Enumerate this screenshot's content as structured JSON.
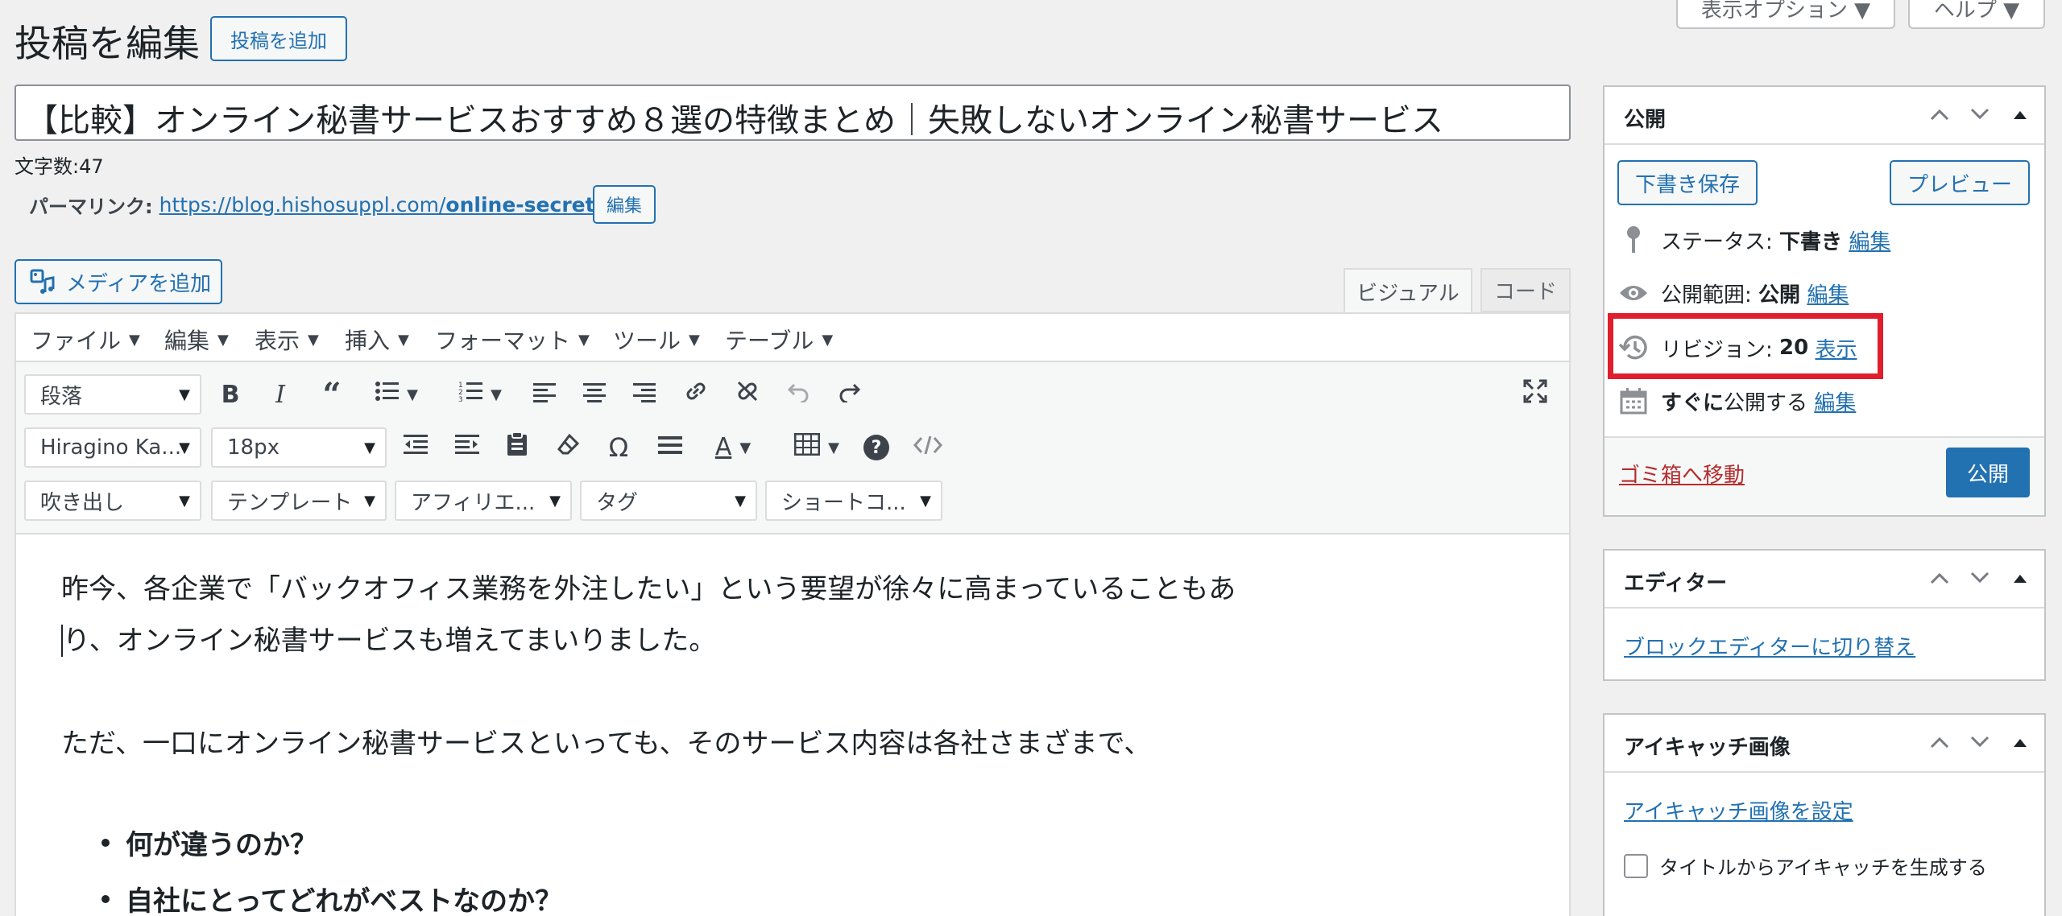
{
  "header": {
    "page_title": "投稿を編集",
    "add_new_label": "投稿を追加",
    "screen_options_label": "表示オプション ▼",
    "help_label": "ヘルプ ▼"
  },
  "post": {
    "title_value": "【比較】オンライン秘書サービスおすすめ８選の特徴まとめ｜失敗しないオンライン秘書サービス",
    "char_count": "文字数:47",
    "permalink_label": "パーマリンク:",
    "permalink_url_base": "https://blog.hishosuppl.com/",
    "permalink_slug": "online-secretary",
    "permalink_url_end": "/",
    "permalink_edit_label": "編集"
  },
  "editor": {
    "add_media_label": "メディアを追加",
    "tab_visual": "ビジュアル",
    "tab_code": "コード",
    "menubar": [
      "ファイル",
      "編集",
      "表示",
      "挿入",
      "フォーマット",
      "ツール",
      "テーブル"
    ],
    "format_select": "段落",
    "font_family_select": "Hiragino Ka...",
    "font_size_select": "18px",
    "row3_selects": [
      "吹き出し",
      "テンプレート",
      "アフィリエ...",
      "タグ",
      "ショートコ..."
    ],
    "content": {
      "p1_line1": "昨今、各企業で「バックオフィス業務を外注したい」という要望が徐々に高まっていることもあ",
      "p1_line2": "り、オンライン秘書サービスも増えてまいりました。",
      "p2": "ただ、一口にオンライン秘書サービスといっても、そのサービス内容は各社さまざまで、",
      "bullets": [
        "何が違うのか？",
        "自社にとってどれがベストなのか？"
      ]
    }
  },
  "publish_box": {
    "title": "公開",
    "save_draft_label": "下書き保存",
    "preview_label": "プレビュー",
    "status_label": "ステータス:",
    "status_value": "下書き",
    "status_edit": "編集",
    "visibility_label": "公開範囲:",
    "visibility_value": "公開",
    "visibility_edit": "編集",
    "revisions_label": "リビジョン:",
    "revisions_value": "20",
    "revisions_link": "表示",
    "schedule_bold": "すぐに",
    "schedule_text": "公開する",
    "schedule_edit": "編集",
    "trash_label": "ゴミ箱へ移動",
    "publish_label": "公開",
    "highlight_color": "#e01e2d"
  },
  "editor_box": {
    "title": "エディター",
    "switch_link": "ブロックエディターに切り替え"
  },
  "eyecatch_box": {
    "title": "アイキャッチ画像",
    "set_link": "アイキャッチ画像を設定",
    "generate_label": "タイトルからアイキャッチを生成する"
  },
  "colors": {
    "accent": "#2271b1",
    "publish_button": "#2271b1",
    "trash": "#b32d2e"
  }
}
